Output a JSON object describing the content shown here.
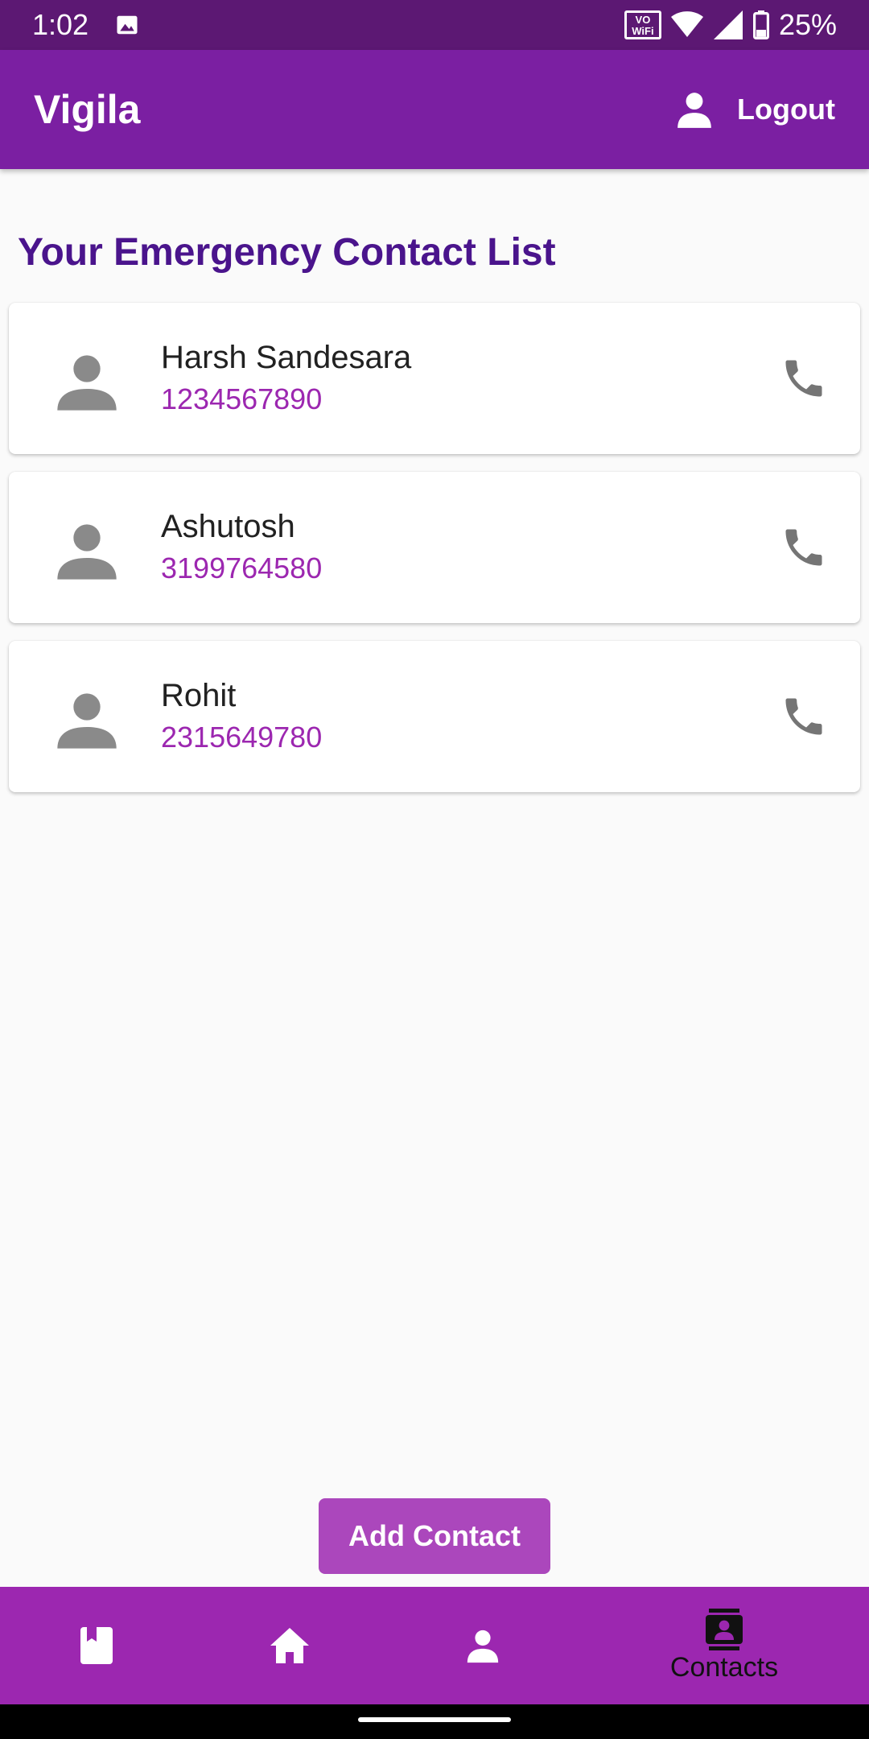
{
  "status_bar": {
    "time": "1:02",
    "wifi_badge_top": "VO",
    "wifi_badge_bottom": "WiFi",
    "battery": "25%"
  },
  "app_bar": {
    "title": "Vigila",
    "logout_label": "Logout",
    "logout_icon": "person-icon"
  },
  "main": {
    "heading": "Your Emergency Contact List",
    "contacts": [
      {
        "name": "Harsh Sandesara",
        "phone": "1234567890"
      },
      {
        "name": "Ashutosh",
        "phone": "3199764580"
      },
      {
        "name": "Rohit",
        "phone": "2315649780"
      }
    ],
    "add_button_label": "Add Contact"
  },
  "bottom_nav": {
    "items": [
      {
        "icon": "book-icon",
        "label": ""
      },
      {
        "icon": "home-icon",
        "label": ""
      },
      {
        "icon": "person-icon",
        "label": ""
      },
      {
        "icon": "contacts-icon",
        "label": "Contacts",
        "selected": true
      }
    ]
  },
  "colors": {
    "status_bar": "#5c1873",
    "app_bar": "#7b1fa2",
    "heading": "#4a148c",
    "phone_text": "#9c27b0",
    "add_button": "#ab47bc",
    "bottom_nav": "#9c27b0"
  }
}
